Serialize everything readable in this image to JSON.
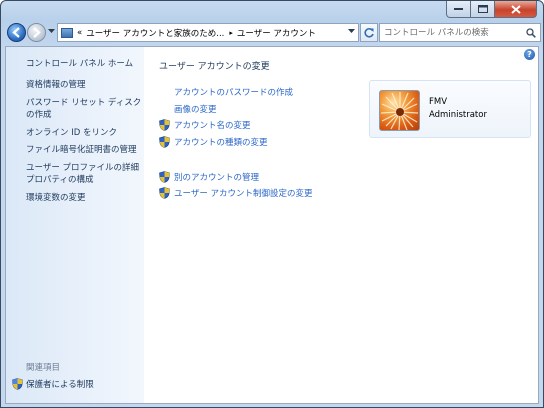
{
  "address": {
    "overflow": "«",
    "crumbs": [
      "ユーザー アカウントと家族のため...",
      "ユーザー アカウント"
    ]
  },
  "search": {
    "placeholder": "コントロール パネルの検索"
  },
  "sidebar": {
    "home": "コントロール パネル ホーム",
    "links": [
      "資格情報の管理",
      "パスワード リセット ディスクの作成",
      "オンライン ID をリンク",
      "ファイル暗号化証明書の管理",
      "ユーザー プロファイルの詳細プロパティの構成",
      "環境変数の変更"
    ],
    "related_heading": "関連項目",
    "parental_controls": "保護者による制限"
  },
  "main": {
    "title": "ユーザー アカウントの変更",
    "tasks_group1": [
      {
        "label": "アカウントのパスワードの作成",
        "shield": false
      },
      {
        "label": "画像の変更",
        "shield": false
      },
      {
        "label": "アカウント名の変更",
        "shield": true
      },
      {
        "label": "アカウントの種類の変更",
        "shield": true
      }
    ],
    "tasks_group2": [
      {
        "label": "別のアカウントの管理",
        "shield": true
      },
      {
        "label": "ユーザー アカウント制御設定の変更",
        "shield": true
      }
    ]
  },
  "user": {
    "name": "FMV",
    "type": "Administrator"
  },
  "colors": {
    "link": "#2a67c9",
    "heading": "#1e395b",
    "sidebar_bg": "#e3edf9"
  },
  "icons": [
    "back-arrow-icon",
    "forward-arrow-icon",
    "refresh-icon",
    "search-icon",
    "help-icon",
    "uac-shield-icon",
    "control-panel-icon"
  ]
}
